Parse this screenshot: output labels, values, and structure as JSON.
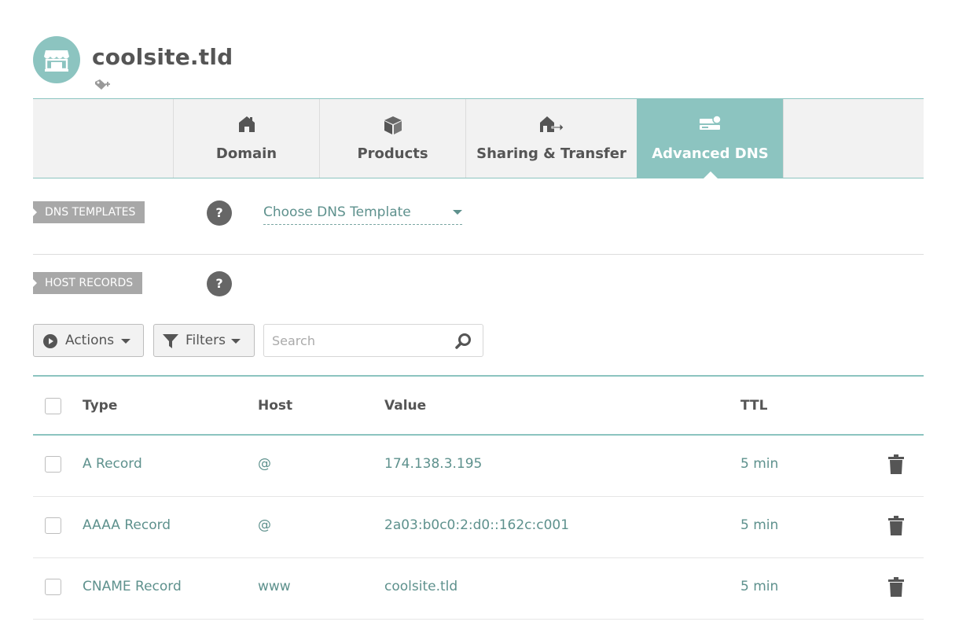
{
  "site": {
    "title": "coolsite.tld",
    "avatar_icon": "storefront-icon",
    "tag_icon": "add-tag-icon"
  },
  "tabs": [
    {
      "label": "Domain",
      "icon": "home-icon",
      "active": false
    },
    {
      "label": "Products",
      "icon": "box-icon",
      "active": false
    },
    {
      "label": "Sharing & Transfer",
      "icon": "transfer-icon",
      "active": false
    },
    {
      "label": "Advanced DNS",
      "icon": "server-icon",
      "active": true
    }
  ],
  "dns_templates": {
    "section_label": "DNS TEMPLATES",
    "help": "?",
    "select_value": "Choose DNS Template"
  },
  "host_records": {
    "section_label": "HOST RECORDS",
    "help": "?"
  },
  "toolbar": {
    "actions_label": "Actions",
    "filters_label": "Filters",
    "search_placeholder": "Search"
  },
  "table": {
    "columns": [
      "Type",
      "Host",
      "Value",
      "TTL"
    ],
    "rows": [
      {
        "type": "A Record",
        "host": "@",
        "value": "174.138.3.195",
        "ttl": "5 min"
      },
      {
        "type": "AAAA Record",
        "host": "@",
        "value": "2a03:b0c0:2:d0::162c:c001",
        "ttl": "5 min"
      },
      {
        "type": "CNAME Record",
        "host": "www",
        "value": "coolsite.tld",
        "ttl": "5 min"
      }
    ]
  },
  "colors": {
    "accent": "#8cc4c0",
    "link": "#5e918d",
    "tab_bg": "#f2f2f2",
    "section_tag": "#a8a8a8"
  }
}
